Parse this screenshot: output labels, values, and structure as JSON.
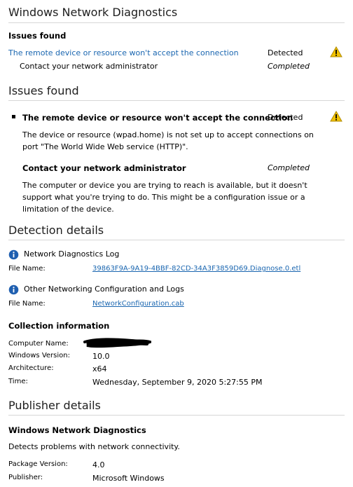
{
  "window_title": "Windows Network Diagnostics",
  "summary": {
    "heading": "Issues found",
    "issue_link": "The remote device or resource won't accept the connection",
    "issue_status": "Detected",
    "action_label": "Contact your network administrator",
    "action_status": "Completed"
  },
  "issues": {
    "heading": "Issues found",
    "issue_title": "The remote device or resource won't accept the connection",
    "issue_status": "Detected",
    "issue_description": "The device or resource (wpad.home) is not set up to accept connections on port \"The World Wide Web service (HTTP)\".",
    "action_title": "Contact your network administrator",
    "action_status": "Completed",
    "action_description": "The computer or device you are trying to reach is available, but it doesn't support what you're trying to do. This might be a configuration issue or a limitation of the device."
  },
  "detection": {
    "heading": "Detection details",
    "log_title": "Network Diagnostics Log",
    "log_file_label": "File Name:",
    "log_file_name": "39863F9A-9A19-4BBF-82CD-34A3F3859D69.Diagnose.0.etl",
    "config_title": "Other Networking Configuration and Logs",
    "config_file_label": "File Name:",
    "config_file_name": "NetworkConfiguration.cab"
  },
  "collection": {
    "heading": "Collection information",
    "computer_name_label": "Computer Name:",
    "windows_version_label": "Windows Version:",
    "windows_version": "10.0",
    "architecture_label": "Architecture:",
    "architecture": "x64",
    "time_label": "Time:",
    "time": "Wednesday, September 9, 2020 5:27:55 PM"
  },
  "publisher": {
    "heading": "Publisher details",
    "name": "Windows Network Diagnostics",
    "description": "Detects problems with network connectivity.",
    "package_version_label": "Package Version:",
    "package_version": "4.0",
    "publisher_label": "Publisher:",
    "publisher_name": "Microsoft Windows"
  },
  "colors": {
    "link": "#1a66b0",
    "warning": "#f2c200",
    "info": "#1f5fb0"
  },
  "icons": {
    "warning": "warning-icon",
    "info": "info-icon"
  }
}
